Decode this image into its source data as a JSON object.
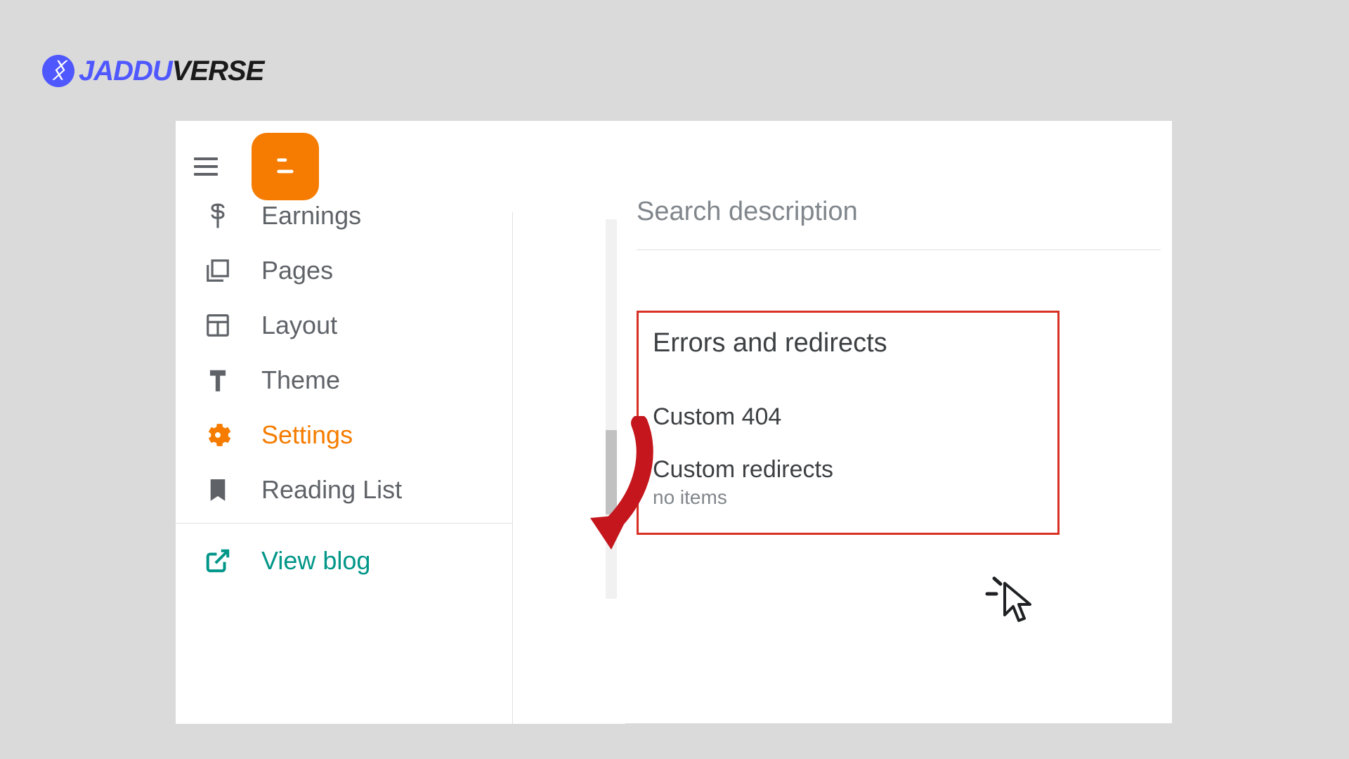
{
  "brand": {
    "glyph": "ᛝ",
    "part1": "JADDU",
    "part2": "VERSE"
  },
  "sidebar": {
    "items": [
      {
        "label": "Earnings"
      },
      {
        "label": "Pages"
      },
      {
        "label": "Layout"
      },
      {
        "label": "Theme"
      },
      {
        "label": "Settings"
      },
      {
        "label": "Reading List"
      }
    ],
    "view_blog": "View blog"
  },
  "main": {
    "search_description": "Search description",
    "errors": {
      "heading": "Errors and redirects",
      "custom_404": "Custom 404",
      "custom_redirects": "Custom redirects",
      "no_items": "no items"
    }
  }
}
